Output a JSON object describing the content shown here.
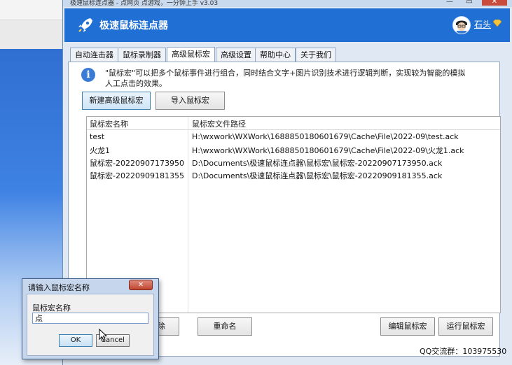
{
  "window": {
    "title": "极速鼠标连点器 - 点网页 点游戏，一分钟上手 v3.03",
    "minimize": "—",
    "maximize": "▭",
    "close": "✕"
  },
  "header": {
    "app_title": "极速鼠标连点器",
    "user_name": "石头"
  },
  "tabs": [
    {
      "label": "自动连击器"
    },
    {
      "label": "鼠标录制器"
    },
    {
      "label": "高级鼠标宏"
    },
    {
      "label": "高级设置"
    },
    {
      "label": "帮助中心"
    },
    {
      "label": "关于我们"
    }
  ],
  "info": {
    "icon": "i",
    "text": "\"鼠标宏\"可以把多个鼠标事件进行组合，同时结合文字+图片识别技术进行逻辑判断，实现较为智能的模拟人工点击的效果。"
  },
  "buttons": {
    "new_macro": "新建高级鼠标宏",
    "import_macro": "导入鼠标宏",
    "remove": "移除",
    "rename": "重命名",
    "edit": "编辑鼠标宏",
    "run": "运行鼠标宏"
  },
  "table": {
    "headers": [
      "鼠标宏名称",
      "鼠标宏文件路径"
    ],
    "rows": [
      [
        "test",
        "H:\\wxwork\\WXWork\\1688850180601679\\Cache\\File\\2022-09\\test.ack"
      ],
      [
        "火龙1",
        "H:\\wxwork\\WXWork\\1688850180601679\\Cache\\File\\2022-09\\火龙1.ack"
      ],
      [
        "鼠标宏-20220907173950",
        "D:\\Documents\\极速鼠标连点器\\鼠标宏\\鼠标宏-20220907173950.ack"
      ],
      [
        "鼠标宏-20220909181355",
        "D:\\Documents\\极速鼠标连点器\\鼠标宏\\鼠标宏-20220909181355.ack"
      ]
    ]
  },
  "footer": {
    "qq_group": "QQ交流群：103975530"
  },
  "dialog": {
    "title": "请输入鼠标宏名称",
    "close": "✕",
    "label": "鼠标宏名称",
    "input_value": "点",
    "ok": "OK",
    "cancel": "Cancel"
  },
  "colors": {
    "header_blue": "#1f6fd5",
    "info_icon_blue": "#3a7bd5"
  }
}
